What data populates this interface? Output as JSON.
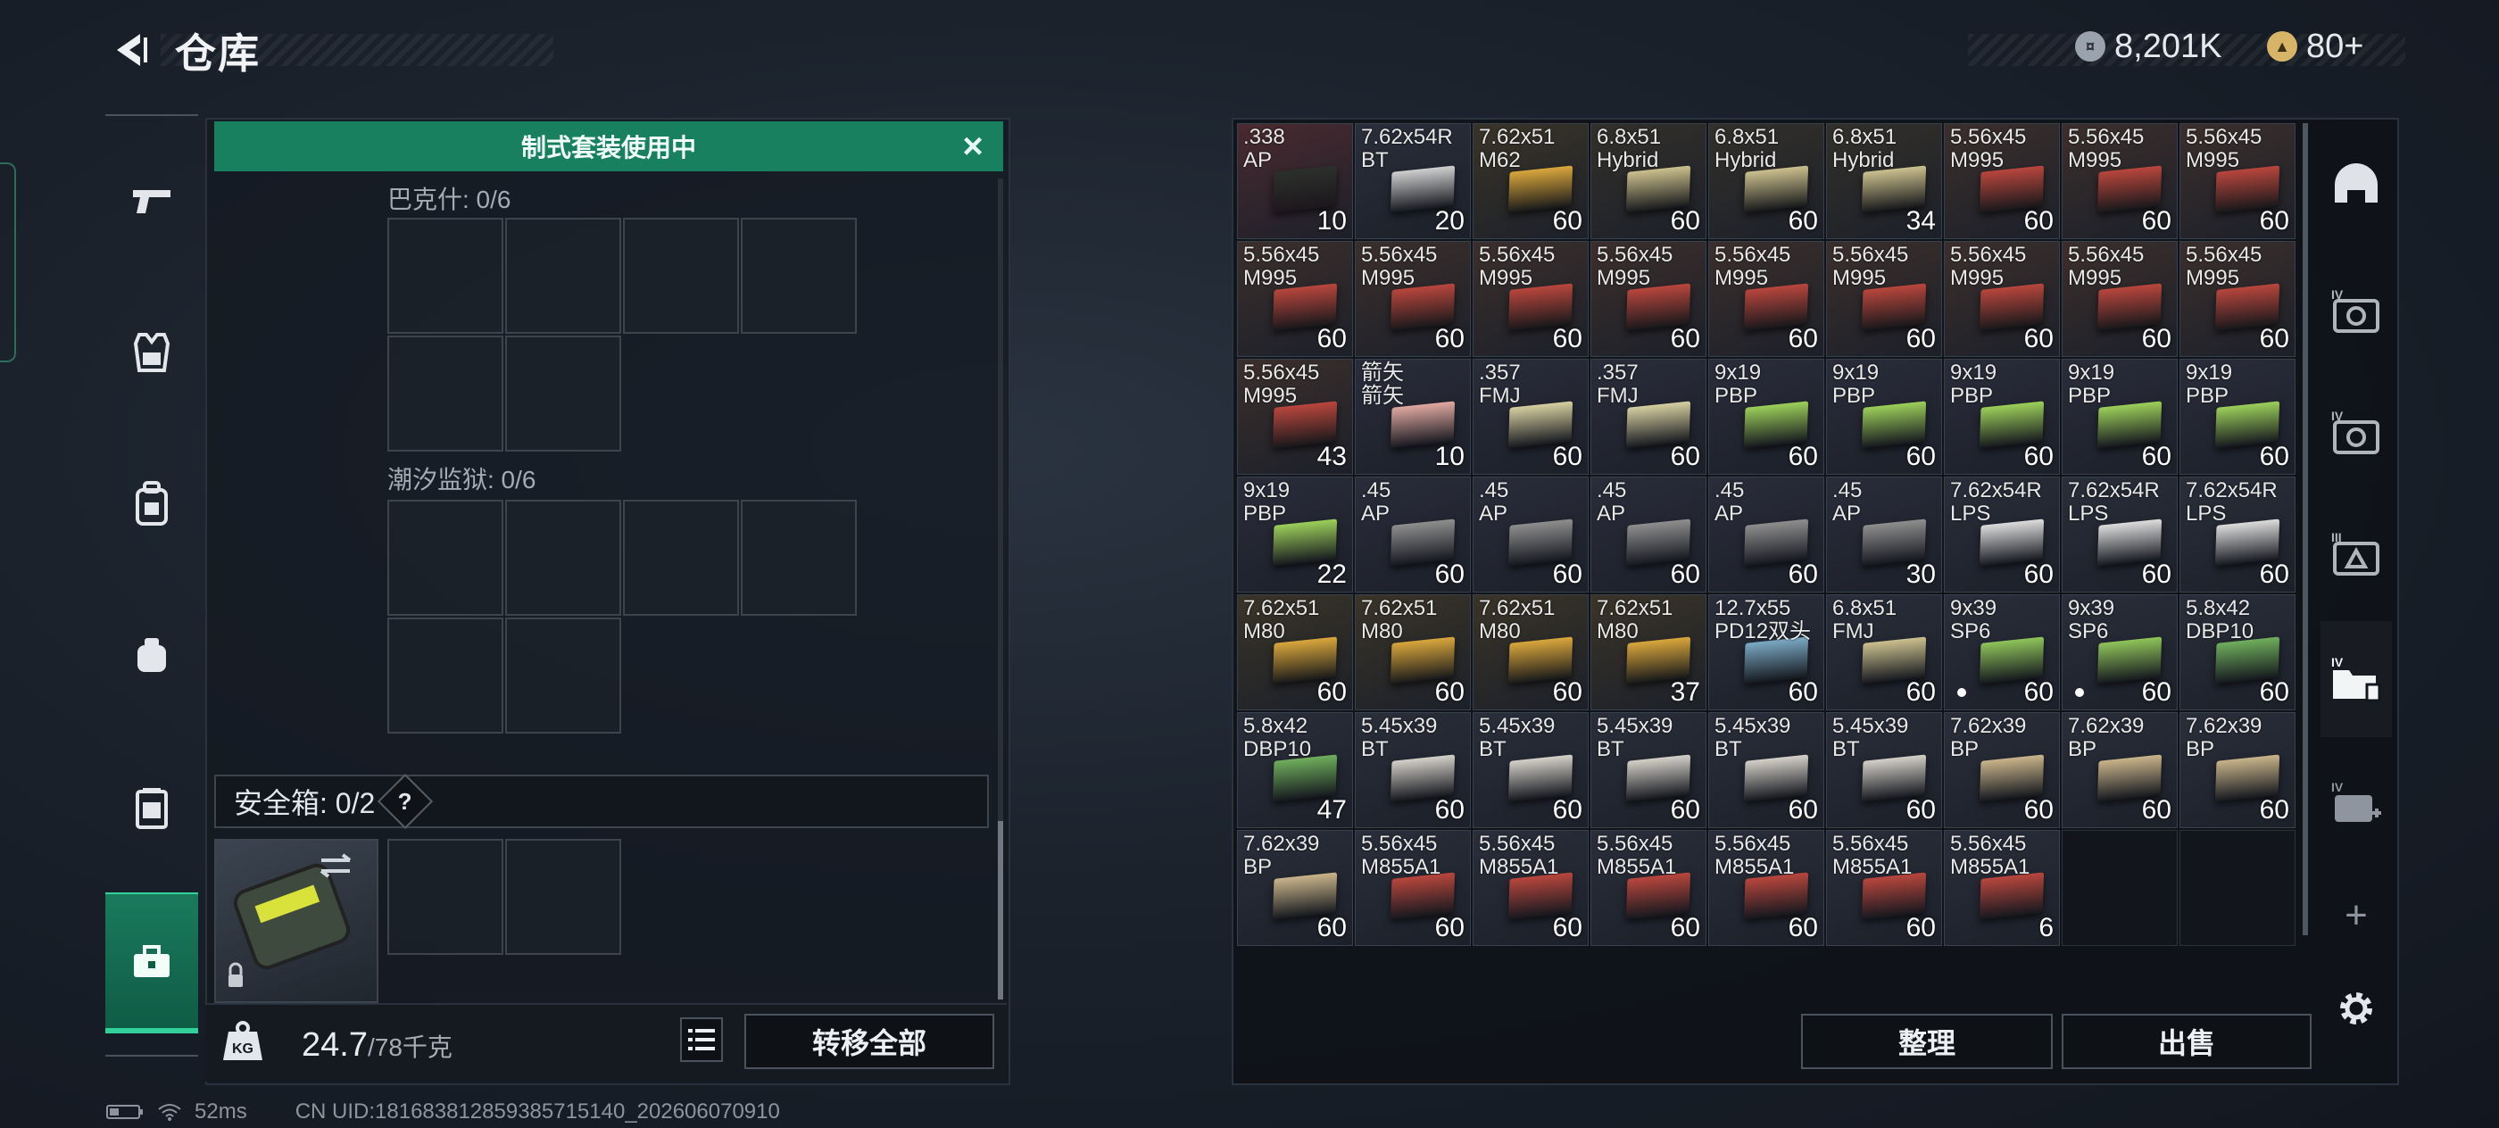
{
  "header": {
    "title": "仓库",
    "currency1": "8,201K",
    "currency2": "80+"
  },
  "banner": {
    "text": "制式套装使用中"
  },
  "left_panel": {
    "grid1_label": "巴克什: 0/6",
    "grid2_label": "潮汐监狱: 0/6",
    "safe_label": "安全箱: 0/2",
    "safe_help": "?",
    "weight_value": "24.7",
    "weight_max": "/78千克",
    "transfer_all": "转移全部",
    "kg_badge": "KG"
  },
  "right_panel": {
    "organize": "整理",
    "sell": "出售",
    "add": "+"
  },
  "status": {
    "ping": "52ms",
    "uid": "CN UID:181683812859385715140_202606070910"
  },
  "items": [
    {
      "name": ".338\nAP",
      "count": "10",
      "bg": "#4a2a30",
      "box": "#2b302c"
    },
    {
      "name": "7.62x54R\nBT",
      "count": "20",
      "bg": "#2a2e3a",
      "box": "#cfcfcf"
    },
    {
      "name": "7.62x51\nM62",
      "count": "60",
      "bg": "#3a3428",
      "box": "#d9a63c"
    },
    {
      "name": "6.8x51\nHybrid",
      "count": "60",
      "bg": "#33302a",
      "box": "#cbc08e"
    },
    {
      "name": "6.8x51\nHybrid",
      "count": "60",
      "bg": "#33302a",
      "box": "#cbc08e"
    },
    {
      "name": "6.8x51\nHybrid",
      "count": "34",
      "bg": "#33302a",
      "box": "#cbc08e"
    },
    {
      "name": "5.56x45\nM995",
      "count": "60",
      "bg": "#3b2f2c",
      "box": "#b8463d"
    },
    {
      "name": "5.56x45\nM995",
      "count": "60",
      "bg": "#3b2f2c",
      "box": "#b8463d"
    },
    {
      "name": "5.56x45\nM995",
      "count": "60",
      "bg": "#3b2f2c",
      "box": "#b8463d"
    },
    {
      "name": "5.56x45\nM995",
      "count": "60",
      "bg": "#3b2f2c",
      "box": "#b8463d"
    },
    {
      "name": "5.56x45\nM995",
      "count": "60",
      "bg": "#3b2f2c",
      "box": "#b8463d"
    },
    {
      "name": "5.56x45\nM995",
      "count": "60",
      "bg": "#3b2f2c",
      "box": "#b8463d"
    },
    {
      "name": "5.56x45\nM995",
      "count": "60",
      "bg": "#3b2f2c",
      "box": "#b8463d"
    },
    {
      "name": "5.56x45\nM995",
      "count": "60",
      "bg": "#3b2f2c",
      "box": "#b8463d"
    },
    {
      "name": "5.56x45\nM995",
      "count": "60",
      "bg": "#3b2f2c",
      "box": "#b8463d"
    },
    {
      "name": "5.56x45\nM995",
      "count": "60",
      "bg": "#3b2f2c",
      "box": "#b8463d"
    },
    {
      "name": "5.56x45\nM995",
      "count": "60",
      "bg": "#3b2f2c",
      "box": "#b8463d"
    },
    {
      "name": "5.56x45\nM995",
      "count": "60",
      "bg": "#3b2f2c",
      "box": "#b8463d"
    },
    {
      "name": "5.56x45\nM995",
      "count": "43",
      "bg": "#3b2f2c",
      "box": "#b8463d"
    },
    {
      "name": "箭矢\n箭矢",
      "count": "10",
      "bg": "#2a2c3a",
      "box": "#e0a8a0"
    },
    {
      "name": ".357\nFMJ",
      "count": "60",
      "bg": "#2a2c3a",
      "box": "#d6cfa0"
    },
    {
      "name": ".357\nFMJ",
      "count": "60",
      "bg": "#2a2c3a",
      "box": "#d6cfa0"
    },
    {
      "name": "9x19\nPBP",
      "count": "60",
      "bg": "#2a2c3a",
      "box": "#9ccf5a"
    },
    {
      "name": "9x19\nPBP",
      "count": "60",
      "bg": "#2a2c3a",
      "box": "#9ccf5a"
    },
    {
      "name": "9x19\nPBP",
      "count": "60",
      "bg": "#2a2c3a",
      "box": "#9ccf5a"
    },
    {
      "name": "9x19\nPBP",
      "count": "60",
      "bg": "#2a2c3a",
      "box": "#9ccf5a"
    },
    {
      "name": "9x19\nPBP",
      "count": "60",
      "bg": "#2a2c3a",
      "box": "#9ccf5a"
    },
    {
      "name": "9x19\nPBP",
      "count": "22",
      "bg": "#2a2c3a",
      "box": "#9ccf5a"
    },
    {
      "name": ".45\nAP",
      "count": "60",
      "bg": "#2a2c3a",
      "box": "#8e8e8e"
    },
    {
      "name": ".45\nAP",
      "count": "60",
      "bg": "#2a2c3a",
      "box": "#8e8e8e"
    },
    {
      "name": ".45\nAP",
      "count": "60",
      "bg": "#2a2c3a",
      "box": "#8e8e8e"
    },
    {
      "name": ".45\nAP",
      "count": "60",
      "bg": "#2a2c3a",
      "box": "#8e8e8e"
    },
    {
      "name": ".45\nAP",
      "count": "30",
      "bg": "#2a2c3a",
      "box": "#8e8e8e"
    },
    {
      "name": "7.62x54R\nLPS",
      "count": "60",
      "bg": "#2a2e3a",
      "box": "#dcdcdc"
    },
    {
      "name": "7.62x54R\nLPS",
      "count": "60",
      "bg": "#2a2e3a",
      "box": "#dcdcdc"
    },
    {
      "name": "7.62x54R\nLPS",
      "count": "60",
      "bg": "#2a2e3a",
      "box": "#dcdcdc"
    },
    {
      "name": "7.62x51\nM80",
      "count": "60",
      "bg": "#3a3428",
      "box": "#d9a63c"
    },
    {
      "name": "7.62x51\nM80",
      "count": "60",
      "bg": "#3a3428",
      "box": "#d9a63c"
    },
    {
      "name": "7.62x51\nM80",
      "count": "60",
      "bg": "#3a3428",
      "box": "#d9a63c"
    },
    {
      "name": "7.62x51\nM80",
      "count": "37",
      "bg": "#3a3428",
      "box": "#d9a63c"
    },
    {
      "name": "12.7x55\nPD12双头",
      "count": "60",
      "bg": "#2a2e3a",
      "box": "#7aa9c4"
    },
    {
      "name": "6.8x51\nFMJ",
      "count": "60",
      "bg": "#2a2e3a",
      "box": "#cbc08e"
    },
    {
      "name": "9x39\nSP6",
      "count": "60",
      "bg": "#2a2e3a",
      "box": "#8fc45a",
      "dot": true
    },
    {
      "name": "9x39\nSP6",
      "count": "60",
      "bg": "#2a2e3a",
      "box": "#8fc45a",
      "dot": true
    },
    {
      "name": "5.8x42\nDBP10",
      "count": "60",
      "bg": "#2a2e3a",
      "box": "#6fae5c"
    },
    {
      "name": "5.8x42\nDBP10",
      "count": "47",
      "bg": "#2a2e3a",
      "box": "#6fae5c"
    },
    {
      "name": "5.45x39\nBT",
      "count": "60",
      "bg": "#2a2e3a",
      "box": "#d4d0c8"
    },
    {
      "name": "5.45x39\nBT",
      "count": "60",
      "bg": "#2a2e3a",
      "box": "#d4d0c8"
    },
    {
      "name": "5.45x39\nBT",
      "count": "60",
      "bg": "#2a2e3a",
      "box": "#d4d0c8"
    },
    {
      "name": "5.45x39\nBT",
      "count": "60",
      "bg": "#2a2e3a",
      "box": "#d4d0c8"
    },
    {
      "name": "5.45x39\nBT",
      "count": "60",
      "bg": "#2a2e3a",
      "box": "#d4d0c8"
    },
    {
      "name": "7.62x39\nBP",
      "count": "60",
      "bg": "#2a2e3a",
      "box": "#c9b48a"
    },
    {
      "name": "7.62x39\nBP",
      "count": "60",
      "bg": "#2a2e3a",
      "box": "#c9b48a"
    },
    {
      "name": "7.62x39\nBP",
      "count": "60",
      "bg": "#2a2e3a",
      "box": "#c9b48a"
    },
    {
      "name": "7.62x39\nBP",
      "count": "60",
      "bg": "#2a2e3a",
      "box": "#c9b48a"
    },
    {
      "name": "5.56x45\nM855A1",
      "count": "60",
      "bg": "#2a2e3a",
      "box": "#b8463d"
    },
    {
      "name": "5.56x45\nM855A1",
      "count": "60",
      "bg": "#2a2e3a",
      "box": "#b8463d"
    },
    {
      "name": "5.56x45\nM855A1",
      "count": "60",
      "bg": "#2a2e3a",
      "box": "#b8463d"
    },
    {
      "name": "5.56x45\nM855A1",
      "count": "60",
      "bg": "#2a2e3a",
      "box": "#b8463d"
    },
    {
      "name": "5.56x45\nM855A1",
      "count": "60",
      "bg": "#2a2e3a",
      "box": "#b8463d"
    },
    {
      "name": "5.56x45\nM855A1",
      "count": "6",
      "bg": "#2a2e3a",
      "box": "#b8463d"
    }
  ],
  "icons": {
    "left_nav": [
      "pistol-icon",
      "vest-icon",
      "backpack-icon",
      "pouch-icon",
      "container-icon",
      "toolbox-icon"
    ],
    "right_nav": [
      "helmet-icon",
      "case-iv-icon",
      "case-iv-icon-2",
      "case-iii-icon",
      "folder-iv-icon",
      "medkit-iv-icon"
    ]
  }
}
